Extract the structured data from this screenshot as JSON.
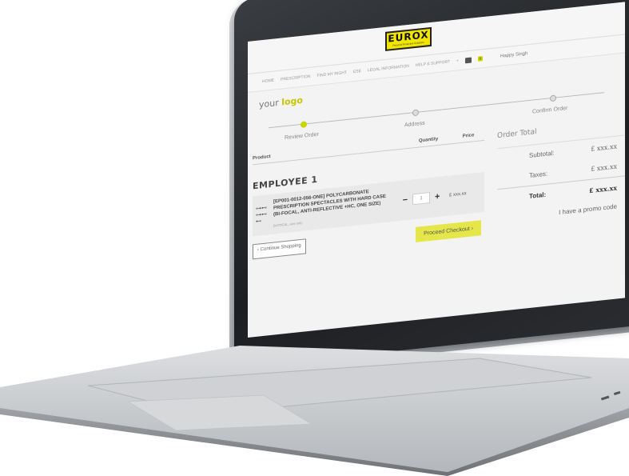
{
  "header": {
    "brand": "EUROX",
    "brand_tagline": "Personal Protective Solutions",
    "nav": [
      "HOME",
      "PRESCRIPTION",
      "FIND MY RIGHT",
      "ESE",
      "LEGAL INFORMATION",
      "HELP & SUPPORT",
      "+"
    ],
    "cart_count": "0",
    "user": "Happy Singh"
  },
  "logo": {
    "prefix": "your ",
    "highlight": "logo"
  },
  "steps": [
    "Review Order",
    "Address",
    "Confirm Order"
  ],
  "table": {
    "product": "Product",
    "quantity": "Quantity",
    "price": "Price"
  },
  "employee": "EMPLOYEE 1",
  "item": {
    "line1": "[EP001-0012-056-ONE] POLYCARBONATE",
    "line2": "PRESCRIPTION SPECTACLES WITH HARD CASE",
    "line3": "(BI-FOCAL, ANTI-REFLECTIVE +HC, ONE SIZE)",
    "note": "BI-FOCAL, size only",
    "qty": "1",
    "price": "£ xxx.xx"
  },
  "buttons": {
    "continue": "Continue Shopping",
    "checkout": "Proceed Checkout"
  },
  "order": {
    "title": "Order Total",
    "subtotal_label": "Subtotal:",
    "subtotal": "£ xxx.xx",
    "taxes_label": "Taxes:",
    "taxes": "£ xxx.xx",
    "total_label": "Total:",
    "total": "£ xxx.xx",
    "promo": "I have a promo code"
  },
  "colors": {
    "accent": "#c9d400",
    "brand_yellow": "#f2e600"
  }
}
